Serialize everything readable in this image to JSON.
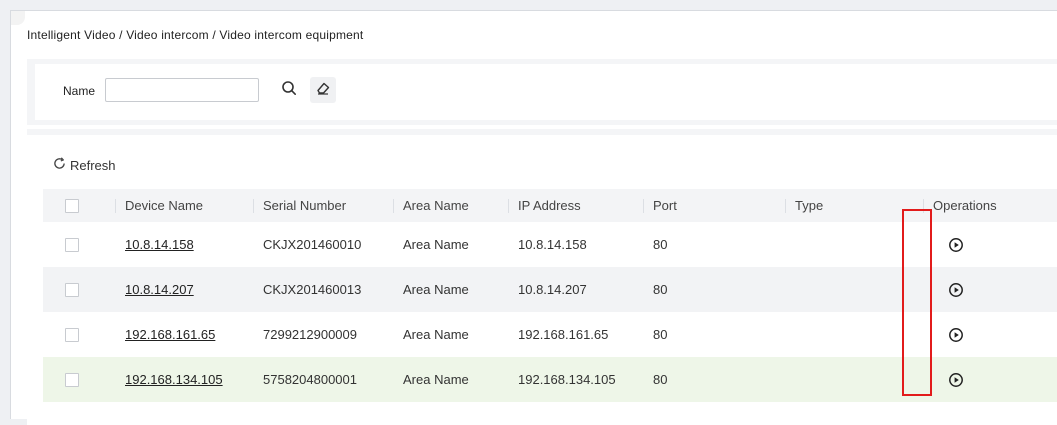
{
  "breadcrumb": {
    "items": [
      "Intelligent Video",
      "Video intercom",
      "Video intercom equipment"
    ],
    "separator": " / "
  },
  "search": {
    "name_label": "Name",
    "name_value": "",
    "name_placeholder": "",
    "search_icon": "search-icon",
    "clear_icon": "eraser-icon"
  },
  "toolbar": {
    "refresh_label": "Refresh",
    "refresh_icon": "refresh-icon"
  },
  "table": {
    "columns": [
      "Device Name",
      "Serial Number",
      "Area Name",
      "IP Address",
      "Port",
      "Type",
      "Operations"
    ],
    "rows": [
      {
        "device_name": "10.8.14.158",
        "serial_number": "CKJX201460010",
        "area_name": "Area Name",
        "ip_address": "10.8.14.158",
        "port": "80",
        "type": "",
        "operation_icon": "play-circle-icon"
      },
      {
        "device_name": "10.8.14.207",
        "serial_number": "CKJX201460013",
        "area_name": "Area Name",
        "ip_address": "10.8.14.207",
        "port": "80",
        "type": "",
        "operation_icon": "play-circle-icon"
      },
      {
        "device_name": "192.168.161.65",
        "serial_number": "7299212900009",
        "area_name": "Area Name",
        "ip_address": "192.168.161.65",
        "port": "80",
        "type": "",
        "operation_icon": "play-circle-icon"
      },
      {
        "device_name": "192.168.134.105",
        "serial_number": "5758204800001",
        "area_name": "Area Name",
        "ip_address": "192.168.134.105",
        "port": "80",
        "type": "",
        "operation_icon": "play-circle-icon"
      }
    ]
  },
  "colors": {
    "highlight_box": "#e21b1b",
    "row_hover": "#eef6e8",
    "row_alt": "#f2f3f5",
    "header_bg": "#f3f4f6"
  }
}
